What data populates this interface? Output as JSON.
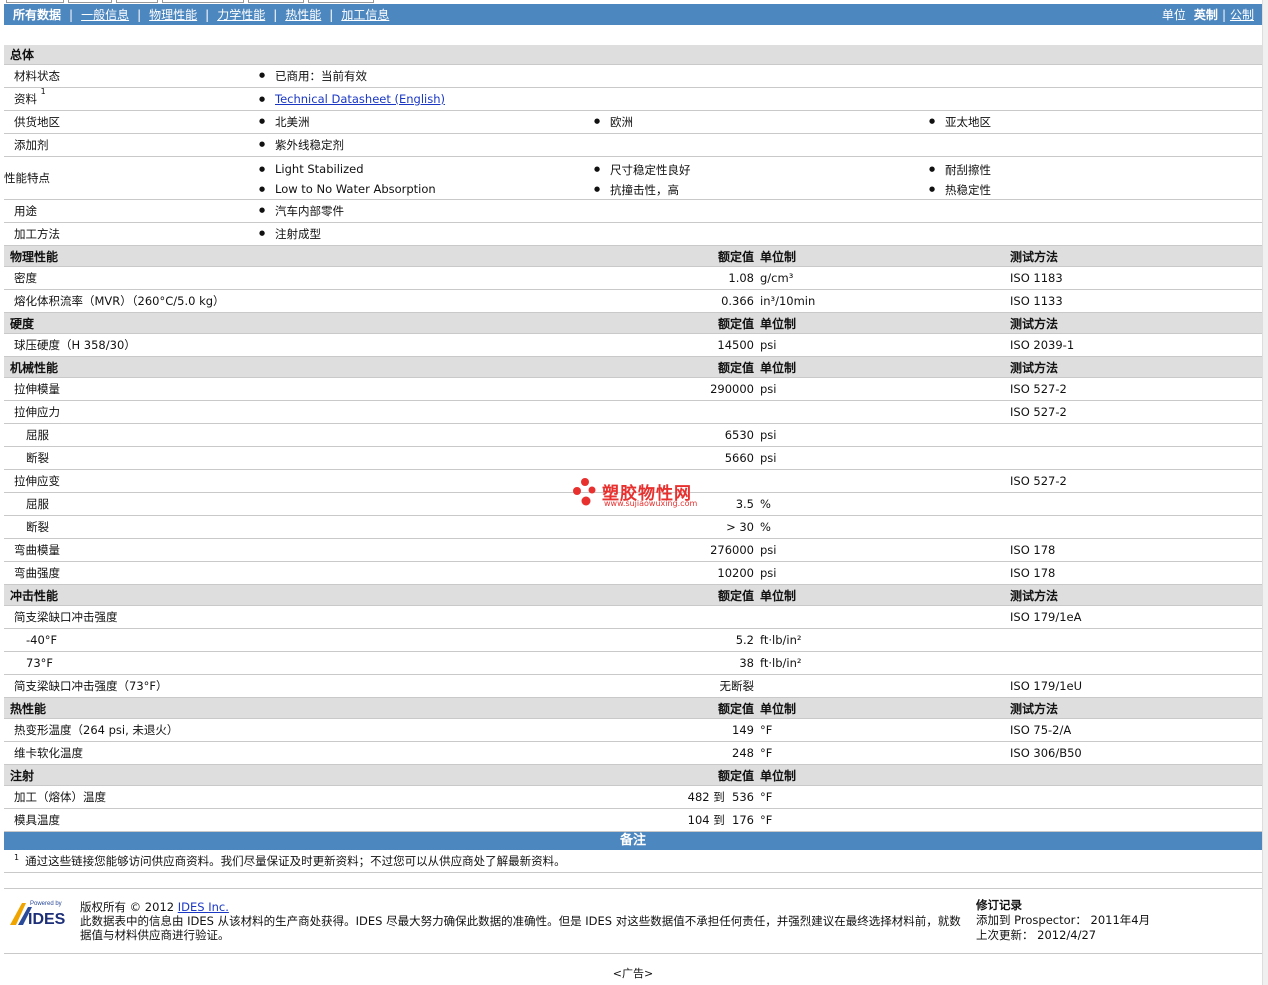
{
  "nav": {
    "tabs": [
      "所有数据",
      "一般信息",
      "物理性能",
      "力学性能",
      "热性能",
      "加工信息"
    ],
    "units_label": "单位",
    "unit_imperial": "英制",
    "unit_metric": "公制"
  },
  "general": {
    "title": "总体",
    "status_label": "材料状态",
    "status_value": "已商用：当前有效",
    "source_label": "资料",
    "source_sup": "1",
    "source_link": "Technical Datasheet (English)",
    "region_label": "供货地区",
    "regions": [
      "北美洲",
      "欧洲",
      "亚太地区"
    ],
    "additive_label": "添加剂",
    "additive_value": "紫外线稳定剂",
    "features_label": "性能特点",
    "features": [
      "Light Stabilized",
      "尺寸稳定性良好",
      "耐刮擦性",
      "Low to No Water Absorption",
      "抗撞击性，高",
      "热稳定性"
    ],
    "use_label": "用途",
    "use_value": "汽车内部零件",
    "process_label": "加工方法",
    "process_value": "注射成型"
  },
  "col": {
    "value": "额定值",
    "unit": "单位制",
    "test": "测试方法"
  },
  "physical": {
    "title": "物理性能",
    "rows": [
      {
        "label": "密度",
        "value": "1.08",
        "unit": "g/cm³",
        "test": "ISO 1183"
      },
      {
        "label": "熔化体积流率（MVR）（260°C/5.0 kg）",
        "value": "0.366",
        "unit": "in³/10min",
        "test": "ISO 1133"
      }
    ]
  },
  "hardness": {
    "title": "硬度",
    "rows": [
      {
        "label": "球压硬度（H 358/30）",
        "value": "14500",
        "unit": "psi",
        "test": "ISO 2039-1"
      }
    ]
  },
  "mechanical": {
    "title": "机械性能",
    "rows": [
      {
        "label": "拉伸模量",
        "value": "290000",
        "unit": "psi",
        "test": "ISO 527-2"
      },
      {
        "label": "拉伸应力",
        "value": "",
        "unit": "",
        "test": "ISO 527-2"
      },
      {
        "label": "屈服",
        "value": "6530",
        "unit": "psi",
        "test": ""
      },
      {
        "label": "断裂",
        "value": "5660",
        "unit": "psi",
        "test": ""
      },
      {
        "label": "拉伸应变",
        "value": "",
        "unit": "",
        "test": "ISO 527-2"
      },
      {
        "label": "屈服",
        "value": "3.5",
        "unit": "%",
        "test": ""
      },
      {
        "label": "断裂",
        "value": "> 30",
        "unit": "%",
        "test": ""
      },
      {
        "label": "弯曲模量",
        "value": "276000",
        "unit": "psi",
        "test": "ISO 178"
      },
      {
        "label": "弯曲强度",
        "value": "10200",
        "unit": "psi",
        "test": "ISO 178"
      }
    ]
  },
  "impact": {
    "title": "冲击性能",
    "rows": [
      {
        "label": "简支梁缺口冲击强度",
        "value": "",
        "unit": "",
        "test": "ISO 179/1eA"
      },
      {
        "label": "-40°F",
        "value": "5.2",
        "unit": "ft·lb/in²",
        "test": ""
      },
      {
        "label": "73°F",
        "value": "38",
        "unit": "ft·lb/in²",
        "test": ""
      },
      {
        "label": "简支梁缺口冲击强度（73°F）",
        "value": "无断裂",
        "unit": "",
        "test": "ISO 179/1eU"
      }
    ]
  },
  "thermal": {
    "title": "热性能",
    "rows": [
      {
        "label": "热变形温度（264 psi, 未退火）",
        "value": "149",
        "unit": "°F",
        "test": "ISO 75-2/A"
      },
      {
        "label": "维卡软化温度",
        "value": "248",
        "unit": "°F",
        "test": "ISO 306/B50"
      }
    ]
  },
  "injection": {
    "title": "注射",
    "rows": [
      {
        "label": "加工（熔体）温度",
        "value": "482 到  536",
        "unit": "°F",
        "test": ""
      },
      {
        "label": "模具温度",
        "value": "104 到  176",
        "unit": "°F",
        "test": ""
      }
    ]
  },
  "notes": {
    "title": "备注",
    "sup": "1",
    "text": "通过这些链接您能够访问供应商资料。我们尽量保证及时更新资料；不过您可以从供应商处了解最新资料。"
  },
  "footer": {
    "powered_by": "Powered by",
    "logo_text": "IDES",
    "copyright_prefix": "版权所有 © 2012",
    "company_link": "IDES Inc.",
    "disclaimer": "此数据表中的信息由 IDES 从该材料的生产商处获得。IDES 尽最大努力确保此数据的准确性。但是 IDES 对这些数据值不承担任何责任，并强烈建议在最终选择材料前，就数据值与材料供应商进行验证。",
    "rev_title": "修订记录",
    "added_label": "添加到 Prospector：",
    "added_value": "2011年4月",
    "updated_label": "上次更新：",
    "updated_value": "2012/4/27",
    "ad": "<广告>"
  },
  "watermark": {
    "text": "塑胶物性网",
    "url": "www.sujiaowuxing.com"
  }
}
